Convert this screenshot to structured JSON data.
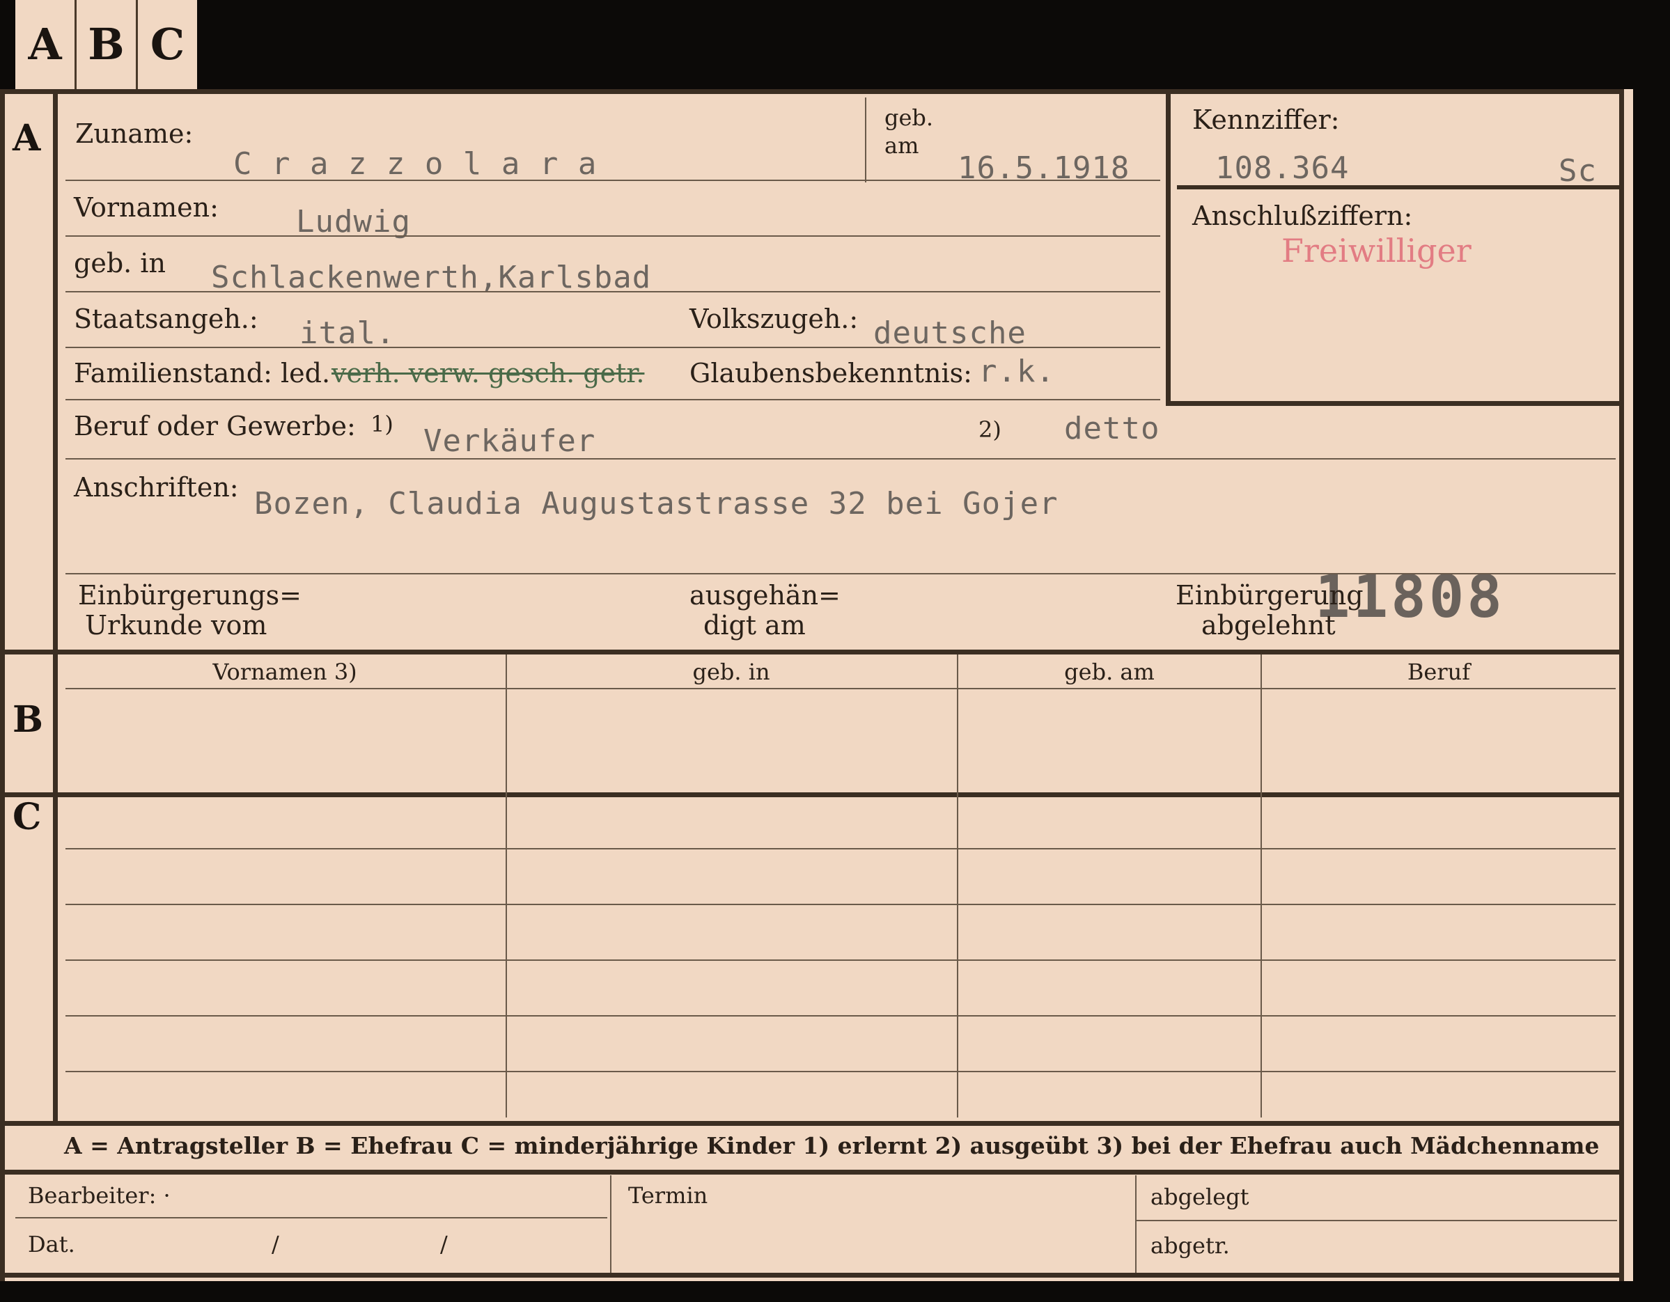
{
  "tabs": [
    "A",
    "B",
    "C"
  ],
  "sections": {
    "a": "A",
    "b": "B",
    "c": "C"
  },
  "labels": {
    "zuname": "Zuname:",
    "geb_am_1": "geb.",
    "geb_am_2": "am",
    "kennziffer": "Kennziffer:",
    "anschluss": "Anschlußziffern:",
    "vornamen": "Vornamen:",
    "geb_in": "geb. in",
    "staatsangeh": "Staatsangeh.:",
    "volkszugeh": "Volkszugeh.:",
    "familienstand": "Familienstand: led.",
    "familienstand_struck": "verh. verw. gesch. getr.",
    "glaubens": "Glaubensbekenntnis:",
    "beruf": "Beruf oder Gewerbe:",
    "beruf_n1": "1)",
    "beruf_n2": "2)",
    "anschriften": "Anschriften:",
    "einb_urk_1": "Einbürgerungs=",
    "einb_urk_2": "Urkunde vom",
    "ausgeh_1": "ausgehän=",
    "ausgeh_2": "digt am",
    "einb_abg_1": "Einbürgerung",
    "einb_abg_2": "abgelehnt"
  },
  "values": {
    "zuname": "C r a z z o l a r a",
    "geb_am": "16.5.1918",
    "kennziffer": "108.364",
    "kennziffer_suffix": "Sc",
    "stamp": "Freiwilliger",
    "vornamen": "Ludwig",
    "geb_in": "Schlackenwerth,Karlsbad",
    "staatsangeh": "ital.",
    "volkszugeh": "deutsche",
    "glaubens": "r.k.",
    "beruf_erlernt": "Verkäufer",
    "beruf_ausgeuebt": "detto",
    "anschrift": "Bozen, Claudia Augustastrasse 32 bei Gojer",
    "number": "11808"
  },
  "table": {
    "headers": [
      "Vornamen 3)",
      "geb. in",
      "geb. am",
      "Beruf"
    ]
  },
  "legend": "A = Antragsteller   B = Ehefrau   C = minderjährige Kinder   1) erlernt   2) ausgeübt   3) bei der Ehefrau auch Mädchenname",
  "footer": {
    "bearbeiter": "Bearbeiter: ·",
    "dat": "Dat.",
    "slash1": "/",
    "slash2": "/",
    "termin": "Termin",
    "abgelegt": "abgelegt",
    "abgetr": "abgetr."
  }
}
